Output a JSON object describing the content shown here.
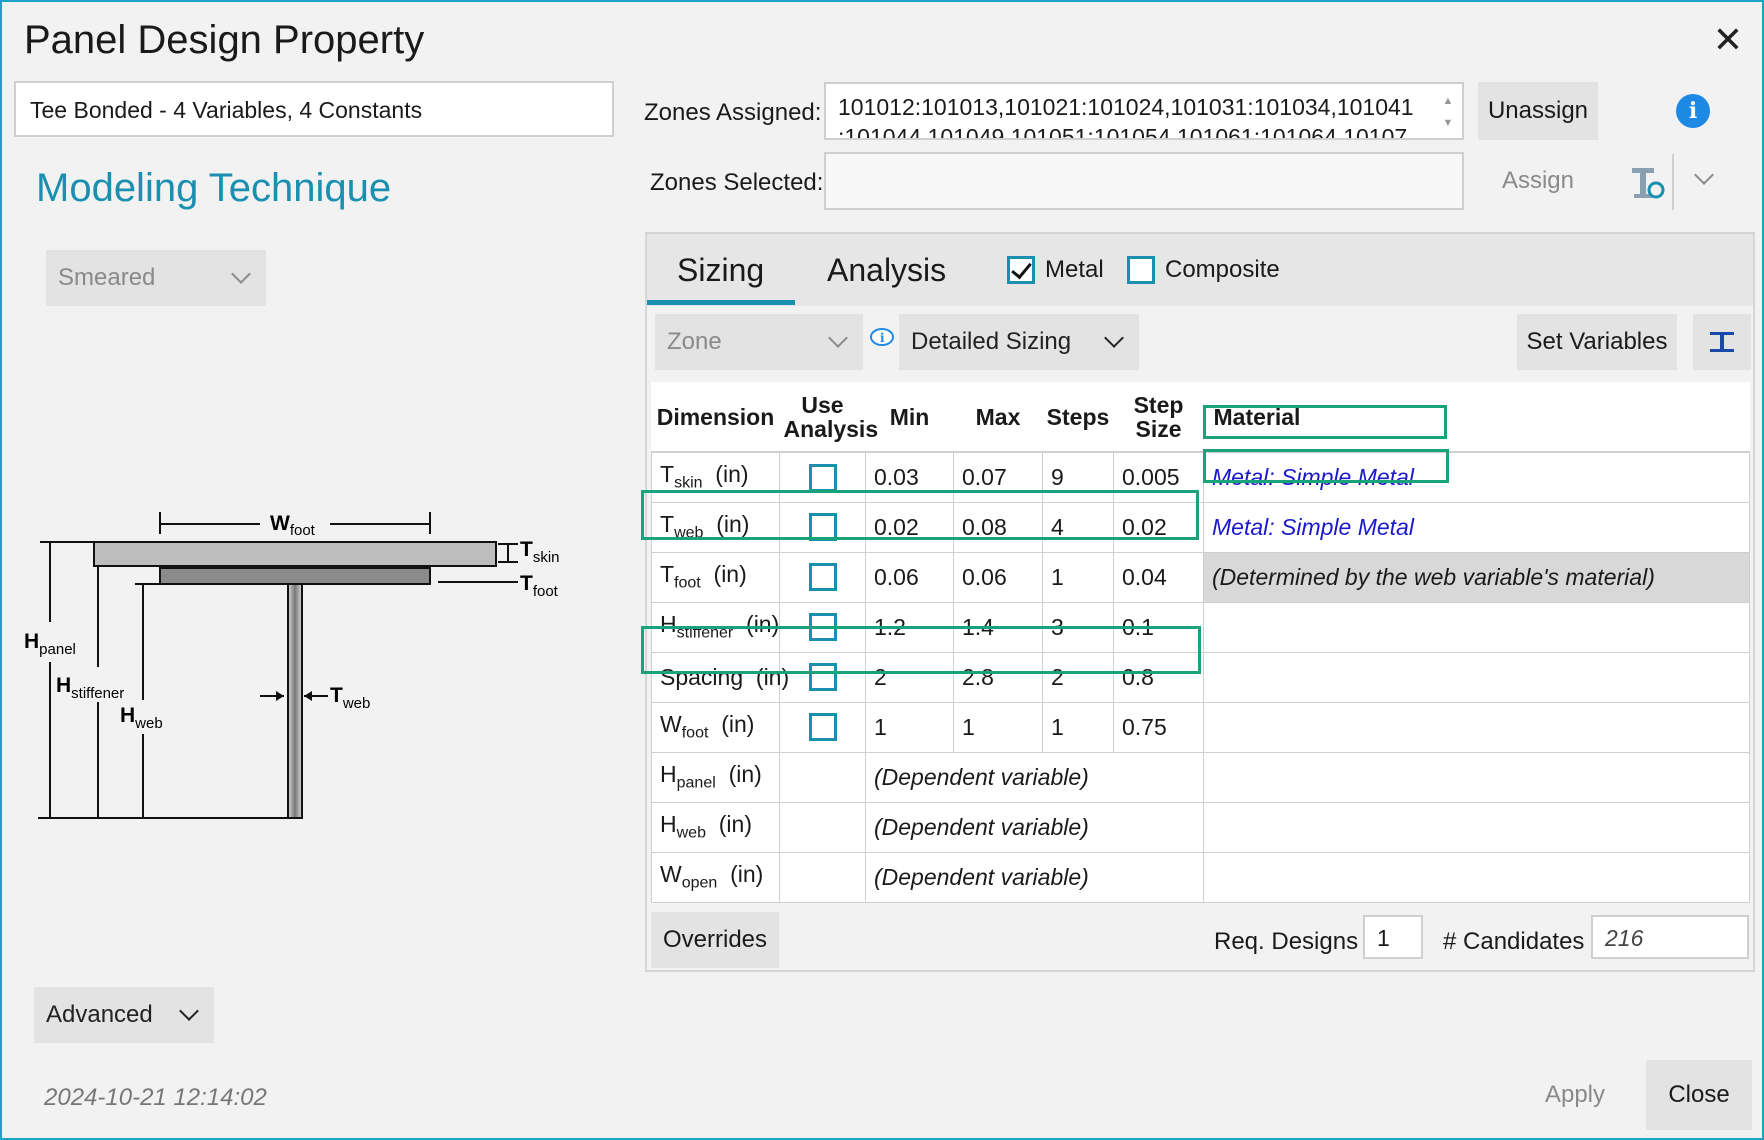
{
  "window": {
    "title": "Panel Design Property"
  },
  "design_name": "Tee Bonded - 4 Variables, 4 Constants",
  "modeling": {
    "heading": "Modeling Technique",
    "technique": "Smeared",
    "advanced_label": "Advanced"
  },
  "timestamp": "2024-10-21 12:14:02",
  "zones": {
    "assigned_label": "Zones Assigned:",
    "assigned_value_line1": "101012:101013,101021:101024,101031:101034,101041",
    "assigned_value_line2": ":101044,101049,101051:101054,101061:101064,10107",
    "selected_label": "Zones Selected:",
    "selected_value": "",
    "unassign_label": "Unassign",
    "assign_label": "Assign"
  },
  "tabs": {
    "sizing": "Sizing",
    "analysis": "Analysis",
    "metal_label": "Metal",
    "metal_checked": true,
    "composite_label": "Composite",
    "composite_checked": false
  },
  "toolbar": {
    "zone_dropdown": "Zone",
    "sizing_mode": "Detailed Sizing",
    "set_variables_label": "Set Variables"
  },
  "table": {
    "headers": {
      "dimension": "Dimension",
      "use_analysis_1": "Use",
      "use_analysis_2": "Analysis",
      "min": "Min",
      "max": "Max",
      "steps": "Steps",
      "step_size_1": "Step",
      "step_size_2": "Size",
      "material": "Material"
    },
    "rows": [
      {
        "dim": "T",
        "sub": "skin",
        "unit": "(in)",
        "min": "0.03",
        "max": "0.07",
        "steps": "9",
        "step_size": "0.005",
        "material": "Metal: Simple Metal"
      },
      {
        "dim": "T",
        "sub": "web",
        "unit": "(in)",
        "min": "0.02",
        "max": "0.08",
        "steps": "4",
        "step_size": "0.02",
        "material": "Metal: Simple Metal"
      },
      {
        "dim": "T",
        "sub": "foot",
        "unit": "(in)",
        "min": "0.06",
        "max": "0.06",
        "steps": "1",
        "step_size": "0.04",
        "material": "(Determined by the web variable's material)"
      },
      {
        "dim": "H",
        "sub": "stiffener",
        "unit": "(in)",
        "min": "1.2",
        "max": "1.4",
        "steps": "3",
        "step_size": "0.1",
        "material": ""
      },
      {
        "dim": "Spacing",
        "sub": "",
        "unit": "(in)",
        "min": "2",
        "max": "2.8",
        "steps": "2",
        "step_size": "0.8",
        "material": ""
      },
      {
        "dim": "W",
        "sub": "foot",
        "unit": "(in)",
        "min": "1",
        "max": "1",
        "steps": "1",
        "step_size": "0.75",
        "material": ""
      },
      {
        "dim": "H",
        "sub": "panel",
        "unit": "(in)",
        "dependent": "(Dependent variable)"
      },
      {
        "dim": "H",
        "sub": "web",
        "unit": "(in)",
        "dependent": "(Dependent variable)"
      },
      {
        "dim": "W",
        "sub": "open",
        "unit": "(in)",
        "dependent": "(Dependent variable)"
      }
    ]
  },
  "footer": {
    "overrides_label": "Overrides",
    "req_designs_label": "Req. Designs",
    "req_designs_value": "1",
    "candidates_label": "# Candidates",
    "candidates_value": "216",
    "apply_label": "Apply",
    "close_label": "Close"
  },
  "diagram": {
    "w_foot": "W",
    "w_foot_sub": "foot",
    "t_skin": "T",
    "t_skin_sub": "skin",
    "t_foot": "T",
    "t_foot_sub": "foot",
    "h_panel": "H",
    "h_panel_sub": "panel",
    "h_stiffener": "H",
    "h_stiffener_sub": "stiffener",
    "h_web": "H",
    "h_web_sub": "web",
    "t_web": "T",
    "t_web_sub": "web"
  },
  "colors": {
    "accent": "#1a8fb0",
    "highlight": "#1aa37a",
    "link": "#1a1acc",
    "info": "#1e88e5"
  }
}
